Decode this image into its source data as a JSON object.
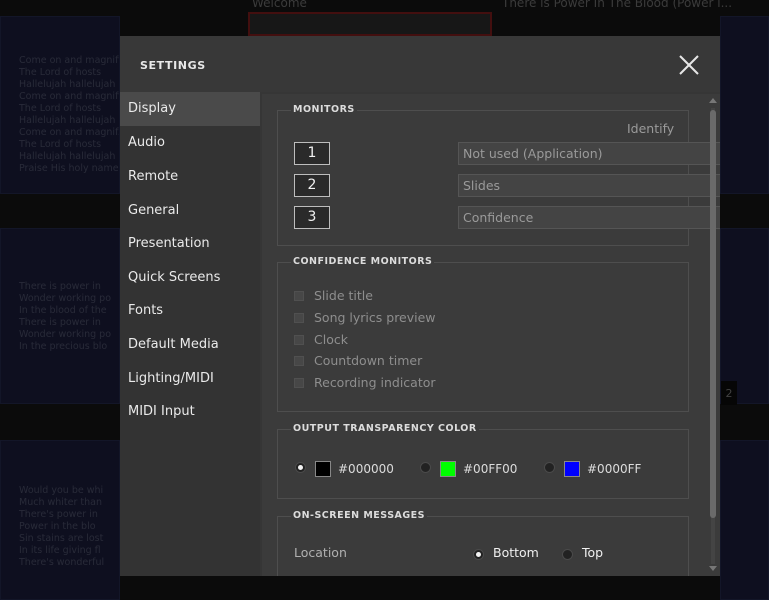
{
  "background": {
    "col2_title": "Welcome",
    "col3_title": "There is Power In The Blood (Power i...",
    "panel1_lines": [
      "Come on and magnify",
      "The Lord of hosts",
      "Hallelujah hallelujah",
      "Come on and magnify",
      "The Lord of hosts",
      "Hallelujah hallelujah",
      "Come on and magnif.",
      "The Lord of hosts",
      "Hallelujah hallelujah",
      "Praise His holy name"
    ],
    "panel2_lines": [
      "There is power in",
      "Wonder working po",
      "In the blood of the",
      "There is power in",
      "Wonder working po",
      "In the precious blo"
    ],
    "panel3_lines": [
      "Would you be whi",
      "Much whiter than",
      "There's power in",
      "Power in the blo",
      "Sin stains are lost",
      "In its life giving fl",
      "There's wonderful"
    ],
    "badge_right": "2"
  },
  "dialog": {
    "title": "SETTINGS",
    "close_icon": "close-icon"
  },
  "sidebar": {
    "items": [
      {
        "label": "Display",
        "active": true
      },
      {
        "label": "Audio"
      },
      {
        "label": "Remote"
      },
      {
        "label": "General"
      },
      {
        "label": "Presentation"
      },
      {
        "label": "Quick Screens"
      },
      {
        "label": "Fonts"
      },
      {
        "label": "Default Media"
      },
      {
        "label": "Lighting/MIDI"
      },
      {
        "label": "MIDI Input"
      }
    ]
  },
  "monitors": {
    "legend": "MONITORS",
    "identify_label": "Identify",
    "rows": [
      {
        "number": "1",
        "value": "Not used (Application)"
      },
      {
        "number": "2",
        "value": "Slides"
      },
      {
        "number": "3",
        "value": "Confidence"
      }
    ]
  },
  "confidence": {
    "legend": "CONFIDENCE MONITORS",
    "options": [
      "Slide title",
      "Song lyrics preview",
      "Clock",
      "Countdown timer",
      "Recording indicator"
    ]
  },
  "transparency": {
    "legend": "OUTPUT TRANSPARENCY COLOR",
    "colors": [
      {
        "label": "#000000",
        "color": "#000000",
        "selected": true
      },
      {
        "label": "#00FF00",
        "color": "#00FF00",
        "selected": false
      },
      {
        "label": "#0000FF",
        "color": "#0000FF",
        "selected": false
      }
    ]
  },
  "messages": {
    "legend": "ON-SCREEN MESSAGES",
    "location_label": "Location",
    "options": [
      {
        "label": "Bottom",
        "selected": true
      },
      {
        "label": "Top",
        "selected": false
      }
    ]
  }
}
